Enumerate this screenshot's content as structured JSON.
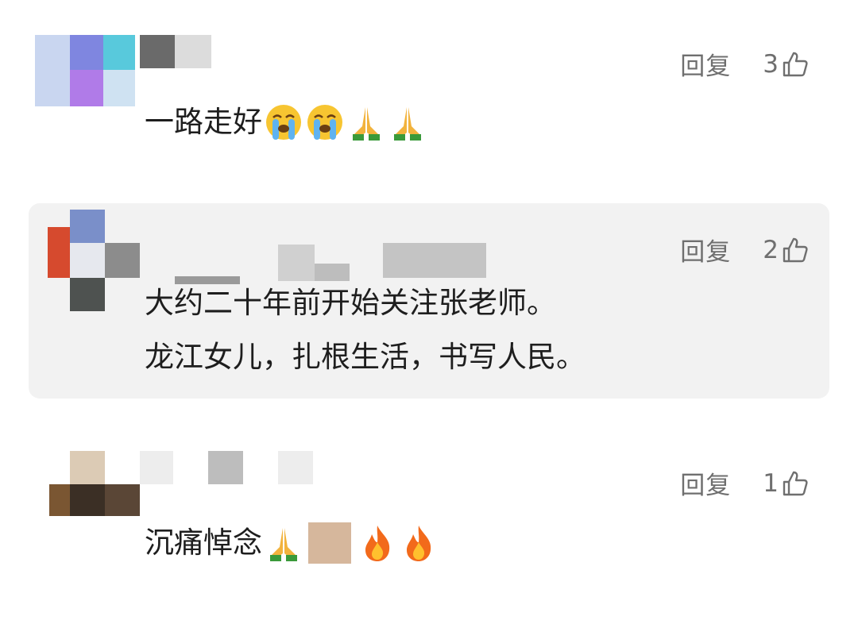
{
  "comments": [
    {
      "text": "一路走好",
      "reply_label": "回复",
      "like_count": "3",
      "emojis": [
        "crying-face",
        "crying-face",
        "folded-hands",
        "folded-hands"
      ]
    },
    {
      "line1": "大约二十年前开始关注张老师。",
      "line2": "龙江女儿，扎根生活，书写人民。",
      "reply_label": "回复",
      "like_count": "2"
    },
    {
      "text": "沉痛悼念",
      "reply_label": "回复",
      "like_count": "1",
      "emojis": [
        "folded-hands",
        "skin-tone-swatch",
        "fire",
        "fire"
      ]
    }
  ],
  "colors": {
    "text": "#1e1e1e",
    "meta": "#6f6f6f",
    "highlight_bg": "#f2f2f2"
  }
}
